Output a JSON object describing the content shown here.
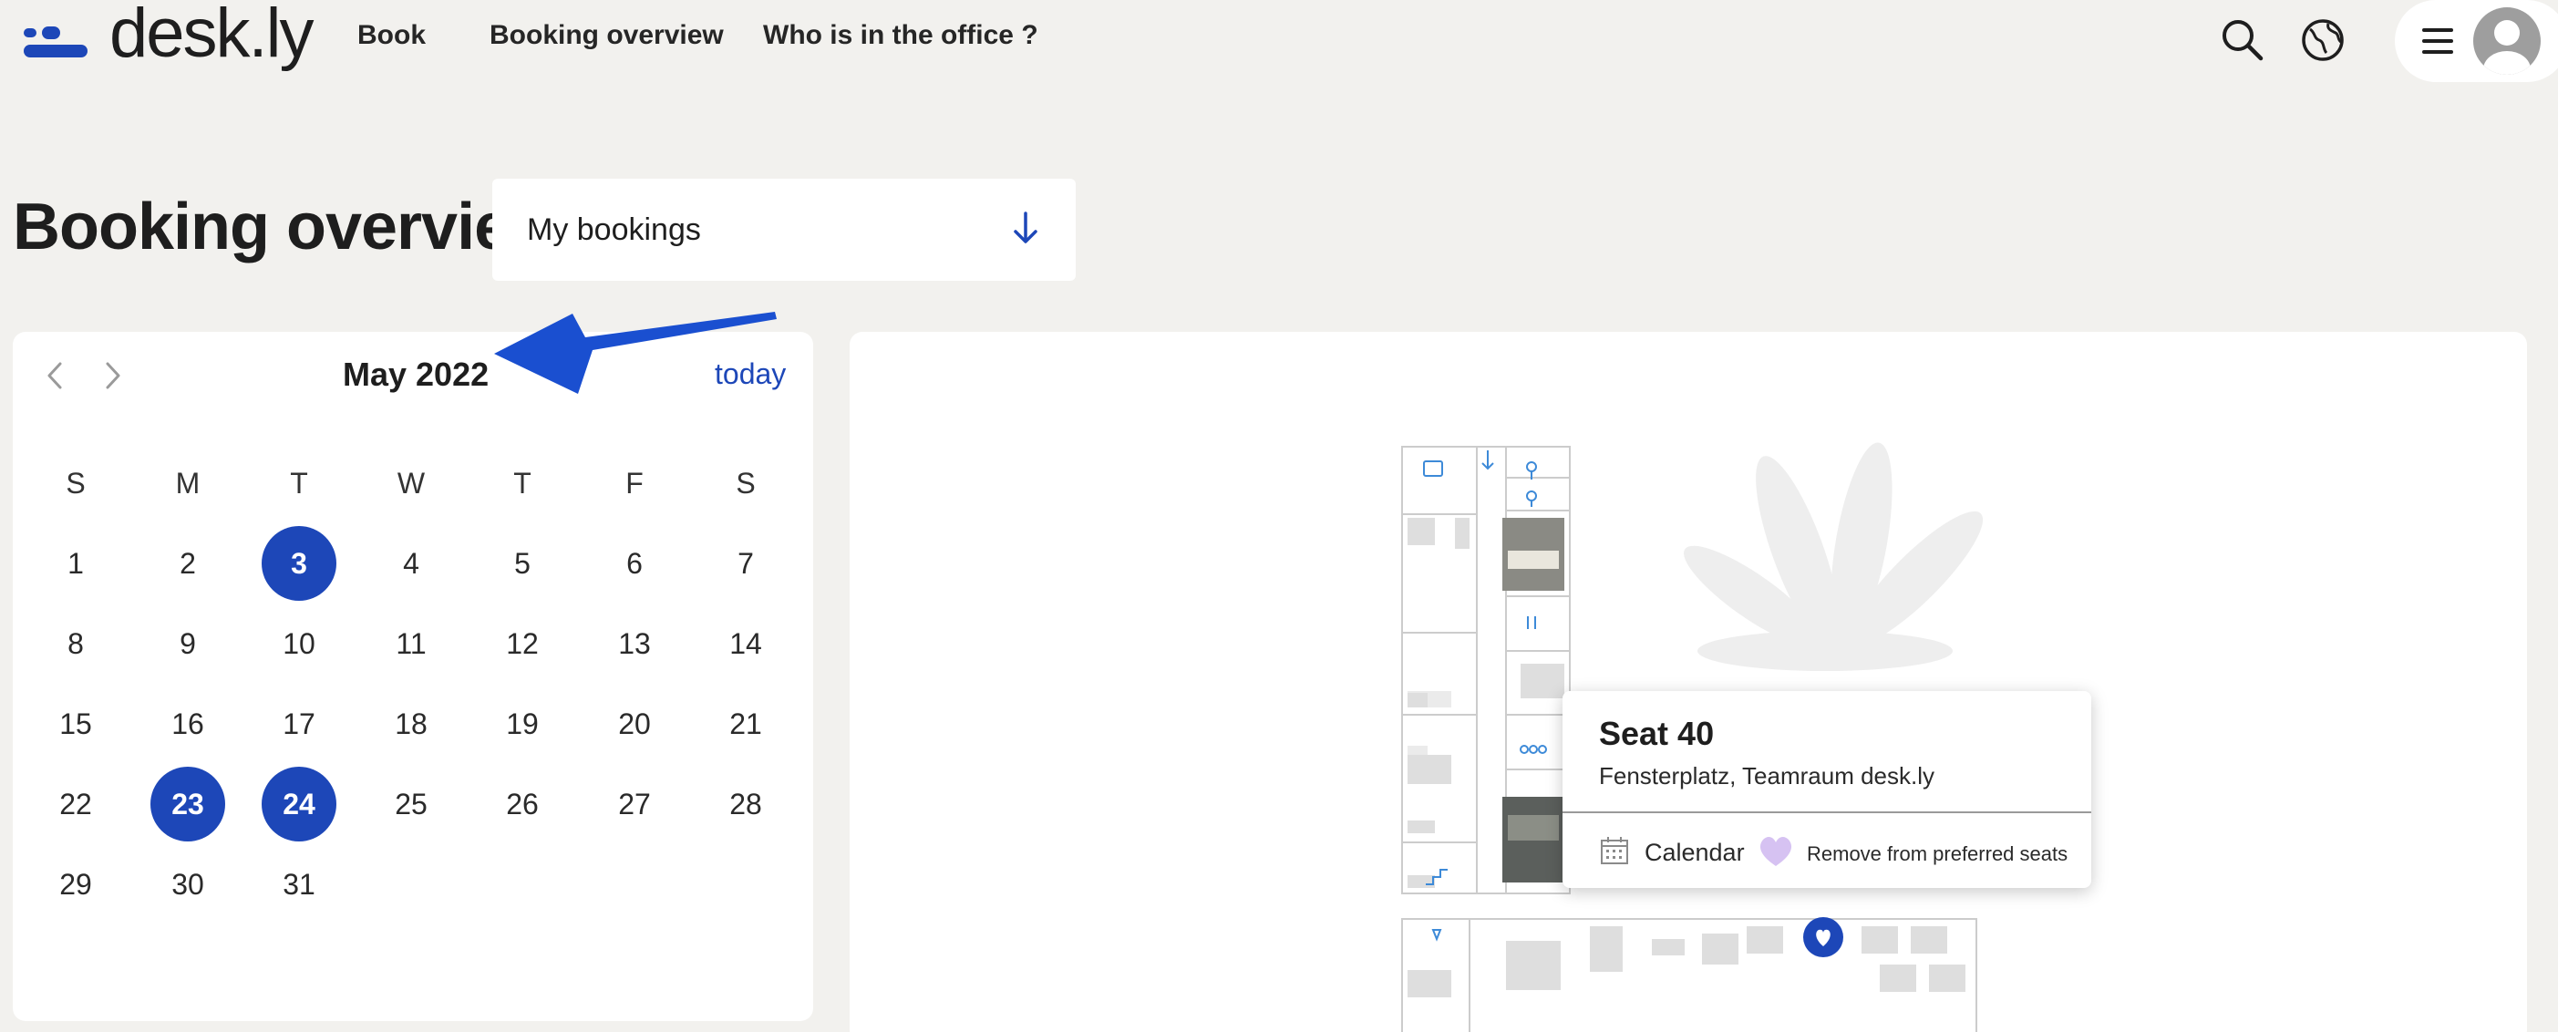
{
  "app": {
    "brand": "desk.ly",
    "accent_color": "#1d47b8"
  },
  "nav": {
    "items": [
      {
        "label": "Book"
      },
      {
        "label": "Booking overview"
      },
      {
        "label": "Who is in the office ?"
      }
    ],
    "icons": [
      "search-icon",
      "globe-icon",
      "hamburger-menu-icon",
      "user-avatar-icon"
    ]
  },
  "page": {
    "title": "Booking overview",
    "filter": {
      "value": "My bookings",
      "icon": "arrow-down-icon"
    }
  },
  "calendar": {
    "month_label": "May 2022",
    "today_label": "today",
    "weekdays": [
      "S",
      "M",
      "T",
      "W",
      "T",
      "F",
      "S"
    ],
    "weeks": [
      [
        1,
        2,
        3,
        4,
        5,
        6,
        7
      ],
      [
        8,
        9,
        10,
        11,
        12,
        13,
        14
      ],
      [
        15,
        16,
        17,
        18,
        19,
        20,
        21
      ],
      [
        22,
        23,
        24,
        25,
        26,
        27,
        28
      ],
      [
        29,
        30,
        31
      ]
    ],
    "booked_days": [
      3,
      23,
      24
    ]
  },
  "seat_popup": {
    "title": "Seat 40",
    "subtitle": "Fensterplatz, Teamraum desk.ly",
    "calendar_label": "Calendar",
    "favorite_label": "Remove from preferred seats",
    "favorite_color": "#d6c2f2"
  }
}
